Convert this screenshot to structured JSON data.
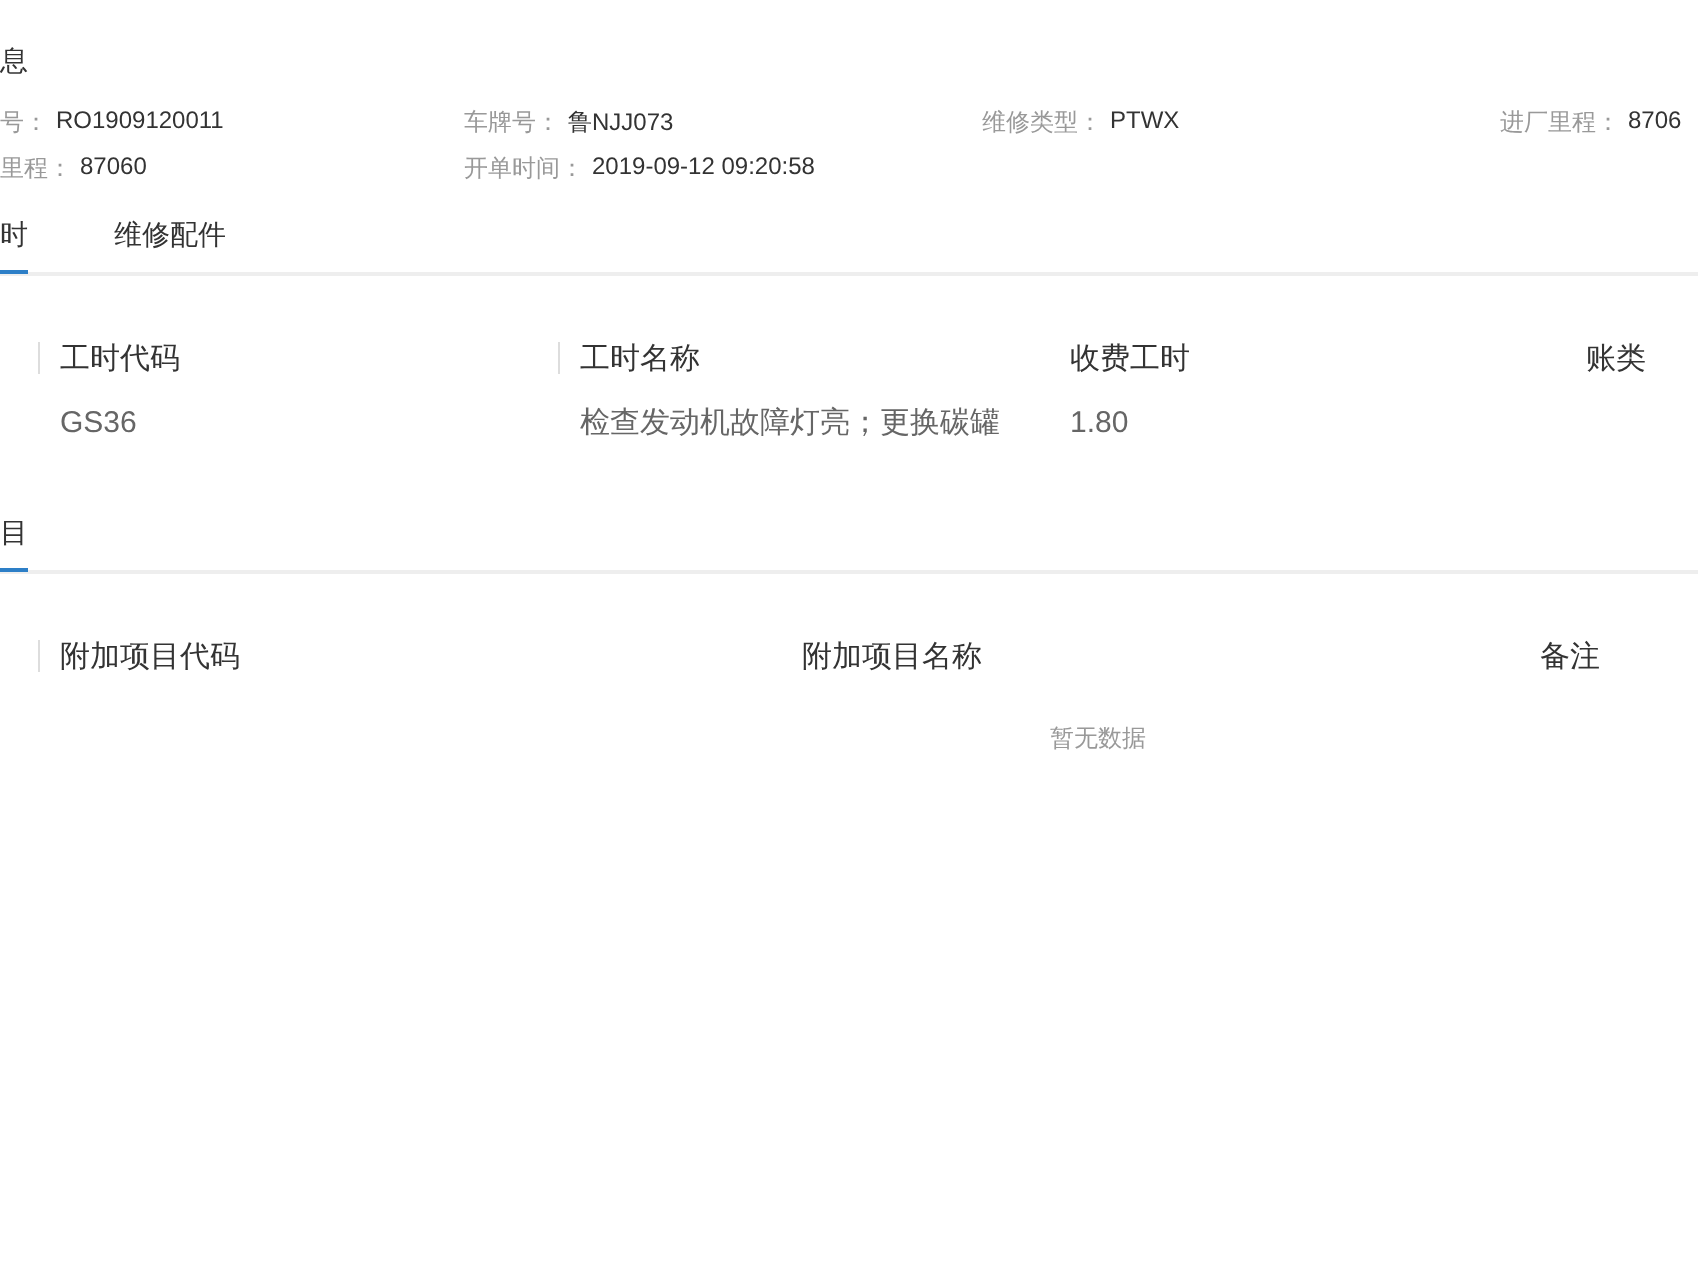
{
  "section_title": "息",
  "info_rows": [
    [
      {
        "label": "号：",
        "value": "RO1909120011"
      },
      {
        "label": "车牌号：",
        "value": "鲁NJJ073"
      },
      {
        "label": "维修类型：",
        "value": "PTWX"
      },
      {
        "label": "进厂里程：",
        "value": "8706"
      }
    ],
    [
      {
        "label": "里程：",
        "value": "87060"
      },
      {
        "label": "开单时间：",
        "value": "2019-09-12 09:20:58"
      }
    ]
  ],
  "tabs": [
    {
      "label": "时",
      "selected": true
    },
    {
      "label": "维修配件",
      "selected": false
    }
  ],
  "labor_table": {
    "columns": [
      "工时代码",
      "工时名称",
      "收费工时",
      "账类"
    ],
    "rows": [
      [
        "GS36",
        "检查发动机故障灯亮；更换碳罐",
        "1.80"
      ]
    ]
  },
  "extra_section": {
    "tab": {
      "label": "目",
      "selected": true
    },
    "columns": [
      "附加项目代码",
      "附加项目名称",
      "备注"
    ],
    "empty_text": "暂无数据"
  }
}
